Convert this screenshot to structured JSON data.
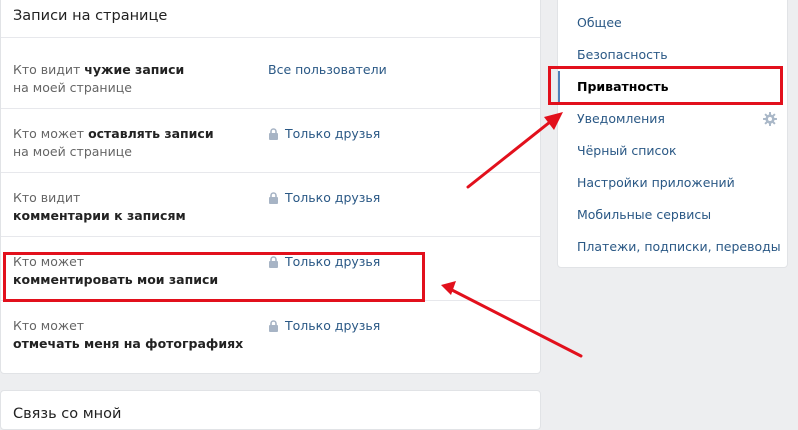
{
  "section": {
    "title": "Записи на странице",
    "rows": [
      {
        "label_1": "Кто видит ",
        "label_1b": "чужие записи",
        "label_2": "на моей странице",
        "label_2b": "",
        "value": "Все пользователи",
        "locked": false
      },
      {
        "label_1": "Кто может ",
        "label_1b": "оставлять записи",
        "label_2": "на моей странице",
        "label_2b": "",
        "value": "Только друзья",
        "locked": true
      },
      {
        "label_1": "Кто видит",
        "label_1b": "",
        "label_2": "",
        "label_2b": "комментарии к записям",
        "value": "Только друзья",
        "locked": true
      },
      {
        "label_1": "Кто может",
        "label_1b": "",
        "label_2": "",
        "label_2b": "комментировать мои записи",
        "value": "Только друзья",
        "locked": true
      },
      {
        "label_1": "Кто может",
        "label_1b": "",
        "label_2": "",
        "label_2b": "отмечать меня на фотографиях",
        "value": "Только друзья",
        "locked": true
      }
    ]
  },
  "next_section": {
    "title": "Связь со мной"
  },
  "menu": {
    "items": [
      {
        "label": "Общее"
      },
      {
        "label": "Безопасность"
      },
      {
        "label": "Приватность",
        "active": true
      },
      {
        "label": "Уведомления",
        "icon": "gear-icon"
      },
      {
        "label": "Чёрный список"
      },
      {
        "label": "Настройки приложений"
      },
      {
        "label": "Мобильные сервисы"
      },
      {
        "label": "Платежи, подписки, переводы"
      }
    ]
  },
  "annotations": {
    "color": "#e2101c"
  }
}
